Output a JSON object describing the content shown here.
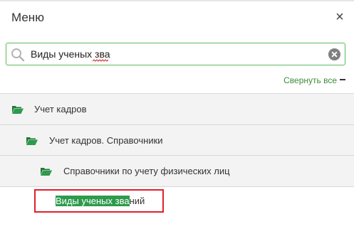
{
  "header": {
    "title": "Меню",
    "close_icon": "close-icon",
    "close_glyph": "×"
  },
  "search": {
    "value": "Виды ученых зва",
    "placeholder": "",
    "search_icon": "search-icon",
    "clear_icon": "clear-icon"
  },
  "controls": {
    "collapse_all_label": "Свернуть все"
  },
  "tree": {
    "items": [
      {
        "label": "Учет кадров",
        "icon": "folder-open-icon",
        "level": 1
      },
      {
        "label": "Учет кадров. Справочники",
        "icon": "folder-open-icon",
        "level": 2
      },
      {
        "label": "Справочники по учету физических лиц",
        "icon": "folder-open-icon",
        "level": 3
      }
    ],
    "result": {
      "matched": "Виды ученых зва",
      "rest": "ний"
    }
  },
  "colors": {
    "accent": "#2e9a4c",
    "search_border": "#5cb85c",
    "highlight_border": "#e0202a",
    "row_bg": "#f3f3f3"
  }
}
